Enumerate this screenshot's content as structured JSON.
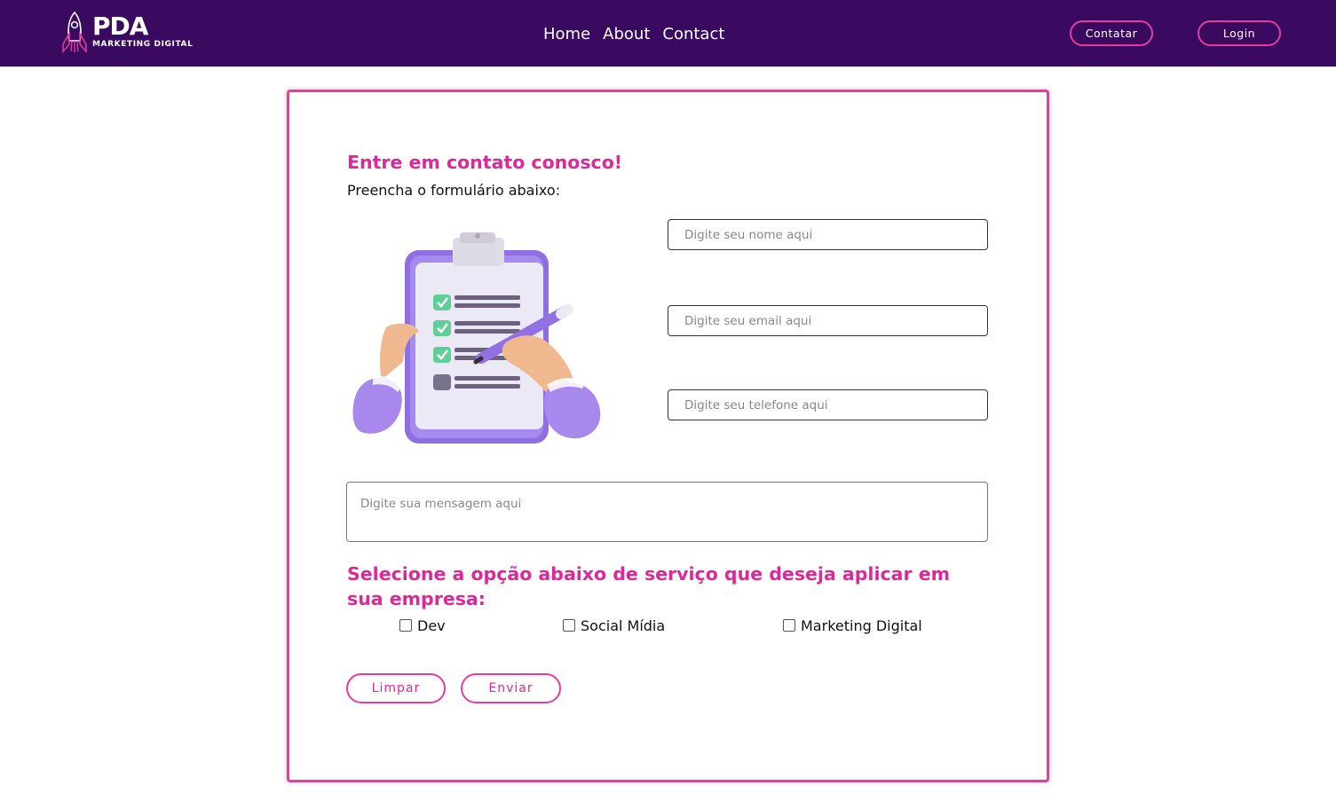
{
  "header": {
    "logo": {
      "title": "PDA",
      "subtitle": "MARKETING DIGITAL"
    },
    "nav": [
      "Home",
      "About",
      "Contact"
    ],
    "buttons": {
      "contatar": "Contatar",
      "login": "Login"
    }
  },
  "form": {
    "title": "Entre em contato conosco!",
    "subtitle": "Preencha o formulário abaixo:",
    "fields": {
      "name_placeholder": "Digite seu nome aqui",
      "email_placeholder": "Digite seu email aqui",
      "phone_placeholder": "Digite seu telefone aqui",
      "message_placeholder": "Digite sua mensagem aqui"
    },
    "question": "Selecione a opção abaixo de serviço que deseja aplicar em sua empresa:",
    "options": [
      "Dev",
      "Social Mídia",
      "Marketing Digital"
    ],
    "buttons": {
      "clear": "Limpar",
      "send": "Enviar"
    }
  },
  "colors": {
    "header_bg": "#3a0a60",
    "accent": "#e33d9e",
    "accent_text": "#e0279a"
  },
  "icons": {
    "logo": "rocket-icon",
    "illustration": "clipboard-checklist-illustration"
  }
}
